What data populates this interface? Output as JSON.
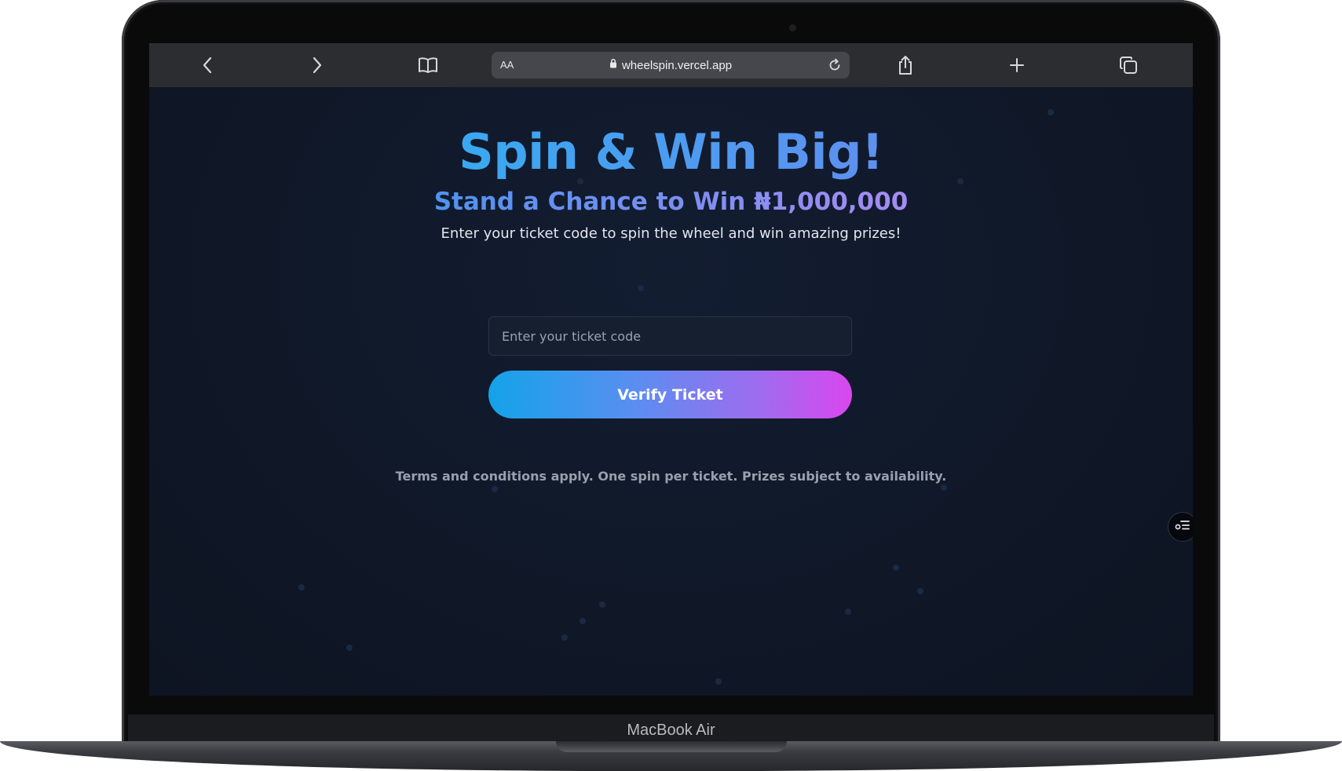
{
  "device": {
    "label": "MacBook Air"
  },
  "browser": {
    "address_bar": {
      "text_size_label": "AA",
      "url": "wheelspin.vercel.app"
    },
    "toolbar_icons": [
      "back-icon",
      "forward-icon",
      "bookmarks-icon",
      "lock-icon",
      "reload-icon",
      "share-icon",
      "new-tab-icon",
      "tabs-overview-icon"
    ]
  },
  "page": {
    "title": "Spin & Win Big!",
    "subtitle": "Stand a Chance to Win ₦1,000,000",
    "tagline": "Enter your ticket code to spin the wheel and win amazing prizes!",
    "ticket_input": {
      "placeholder": "Enter your ticket code",
      "value": ""
    },
    "verify_button_label": "Verify Ticket",
    "terms": "Terms and conditions apply. One spin per ticket. Prizes subject to availability.",
    "floating_button_icon": "options-list-icon"
  },
  "colors": {
    "page_background": "#101827",
    "title_gradient": [
      "#39a9f0",
      "#5f8ff0"
    ],
    "subtitle_gradient": [
      "#4e93f0",
      "#a68bf3"
    ],
    "button_gradient": [
      "#13a3e8",
      "#d947ef"
    ],
    "muted_text": "#99a0ad"
  }
}
